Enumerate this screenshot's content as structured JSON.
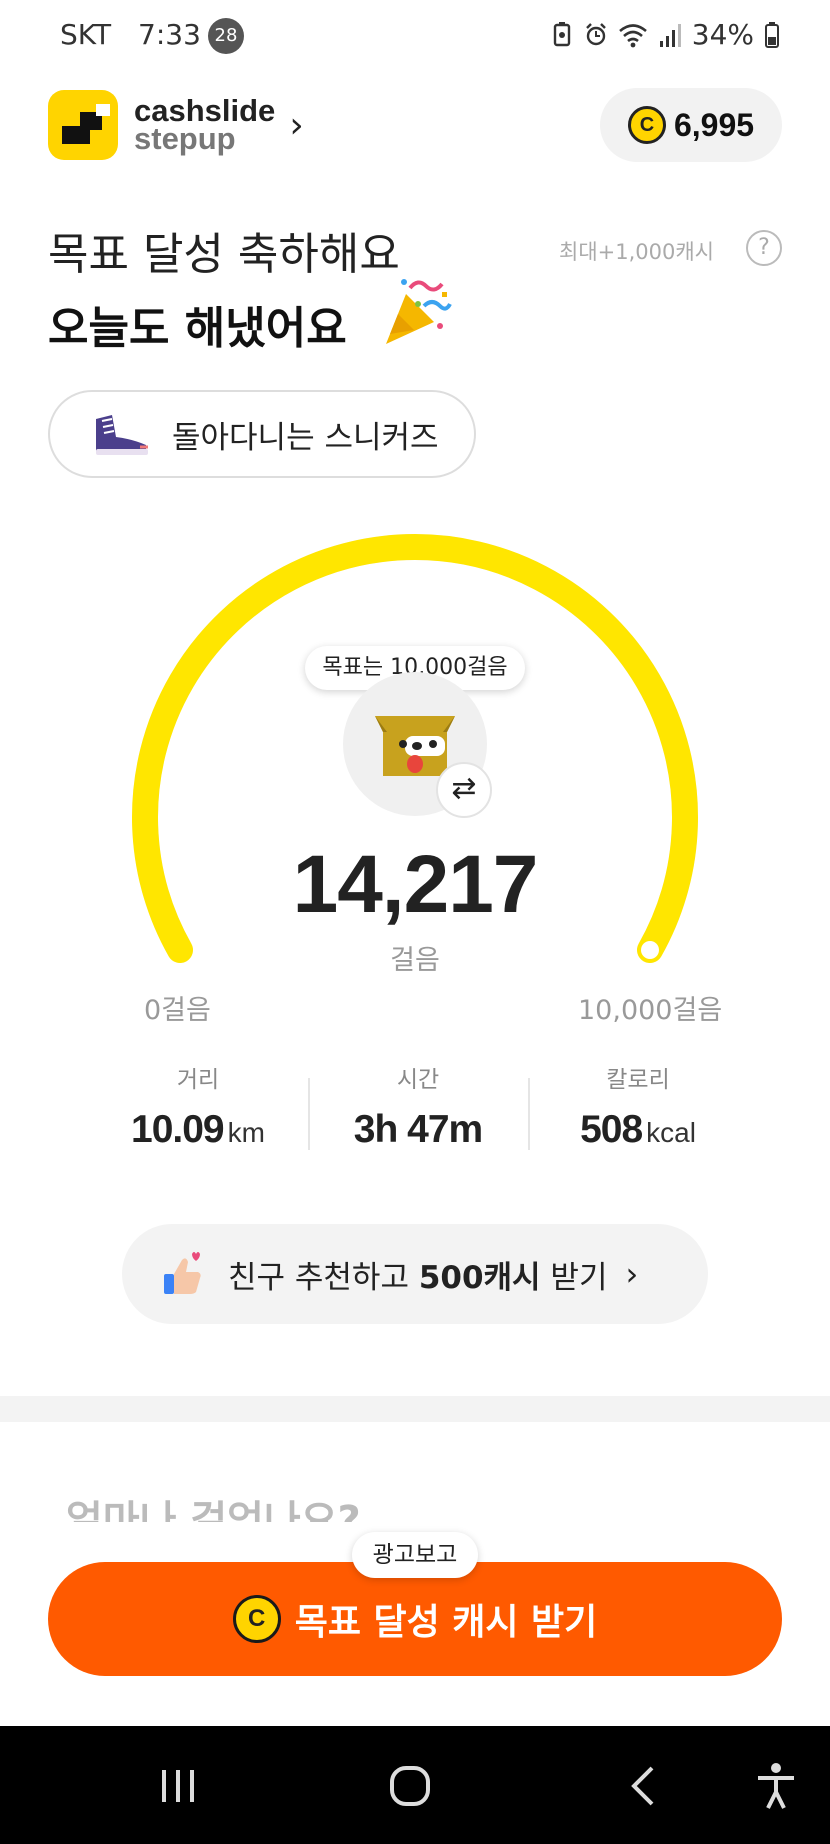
{
  "status_bar": {
    "carrier": "SKT",
    "time": "7:33",
    "notification_count": "28",
    "battery_percent": "34%"
  },
  "header": {
    "brand_name": "cashslide",
    "brand_sub": "stepup",
    "cash_balance": "6,995",
    "coin_symbol": "C"
  },
  "title": {
    "line1": "목표 달성 축하해요",
    "line2": "오늘도 해냈어요",
    "max_reward_note": "최대+1,000캐시",
    "help_symbol": "?"
  },
  "shoe": {
    "label": "돌아다니는 스니커즈"
  },
  "gauge": {
    "goal_tooltip": "목표는 10,000걸음",
    "steps": "14,217",
    "steps_unit": "걸음",
    "min_label": "0걸음",
    "max_label": "10,000걸음",
    "progress_fraction": 1.0,
    "accent_color": "#FFE600",
    "swap_symbol": "⇄"
  },
  "stats": {
    "distance_label": "거리",
    "distance_value": "10.09",
    "distance_unit": "km",
    "time_label": "시간",
    "time_value": "3h 47m",
    "calorie_label": "칼로리",
    "calorie_value": "508",
    "calorie_unit": "kcal"
  },
  "referral": {
    "text_pre": "친구 추천하고 ",
    "text_bold": "500캐시",
    "text_post": " 받기"
  },
  "section_peek": {
    "title": "얼마나 걸었나요?"
  },
  "cta": {
    "ad_tooltip": "광고보고",
    "label": "목표 달성 캐시 받기",
    "color": "#FF5A00"
  },
  "icons": {
    "status": [
      "battery-saver-icon",
      "alarm-icon",
      "wifi-icon",
      "signal-icon",
      "battery-icon"
    ],
    "nav": [
      "recents-icon",
      "home-icon",
      "back-icon",
      "accessibility-icon"
    ]
  }
}
